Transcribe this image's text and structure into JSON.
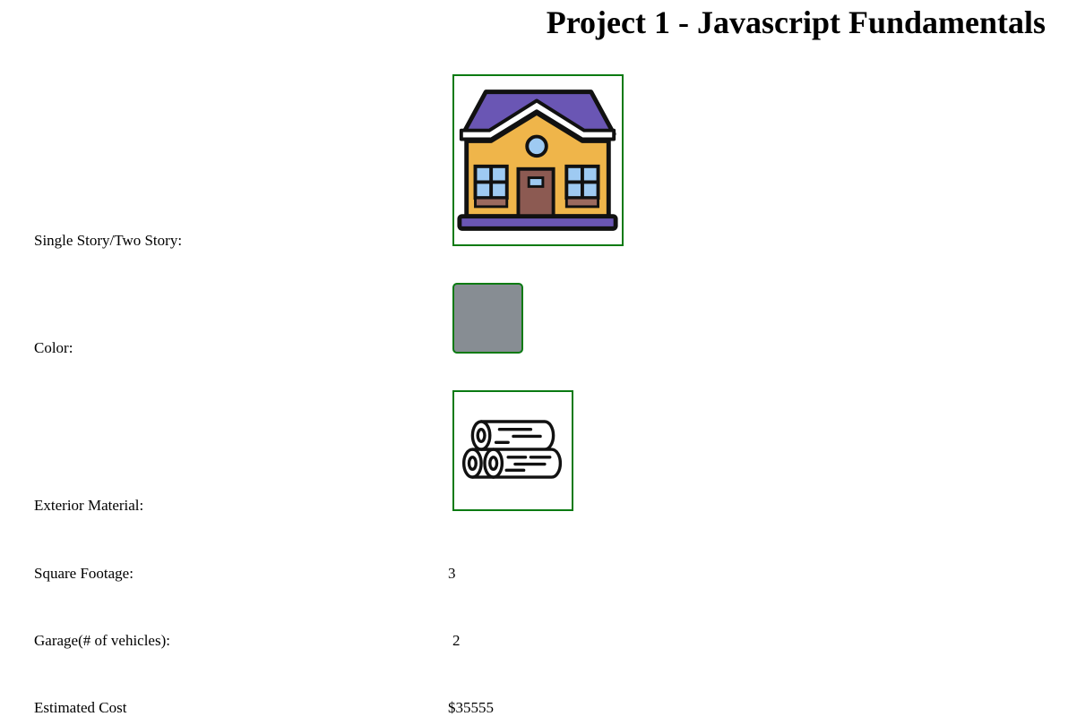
{
  "header": {
    "title": "Project 1 - Javascript Fundamentals"
  },
  "fields": {
    "story": {
      "label": "Single Story/Two Story:",
      "icon": "house-icon"
    },
    "color": {
      "label": "Color:",
      "swatch_color": "#878d93"
    },
    "material": {
      "label": "Exterior Material:",
      "icon": "wood-logs-icon"
    },
    "square_footage": {
      "label": "Square Footage:",
      "value": "3"
    },
    "garage": {
      "label": "Garage(# of vehicles):",
      "value": "2"
    },
    "cost": {
      "label": "Estimated Cost",
      "value": "$35555"
    }
  },
  "colors": {
    "selection_border": "#0a7a12",
    "roof": "#6a56b4",
    "wall": "#efb54a",
    "window": "#9ecaf2",
    "door": "#8c5a52"
  }
}
